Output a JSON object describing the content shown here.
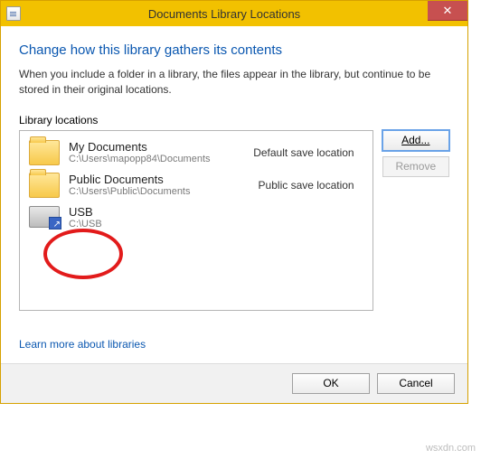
{
  "window": {
    "title": "Documents Library Locations"
  },
  "heading": "Change how this library gathers its contents",
  "description": "When you include a folder in a library, the files appear in the library, but continue to be stored in their original locations.",
  "section_label": "Library locations",
  "buttons": {
    "add": "Add...",
    "remove": "Remove",
    "ok": "OK",
    "cancel": "Cancel"
  },
  "locations": [
    {
      "name": "My Documents",
      "path": "C:\\Users\\mapopp84\\Documents",
      "tag": "Default save location",
      "icon": "folder"
    },
    {
      "name": "Public Documents",
      "path": "C:\\Users\\Public\\Documents",
      "tag": "Public save location",
      "icon": "folder"
    },
    {
      "name": "USB",
      "path": "C:\\USB",
      "tag": "",
      "icon": "drive"
    }
  ],
  "link": "Learn more about libraries",
  "watermark": "wsxdn.com"
}
